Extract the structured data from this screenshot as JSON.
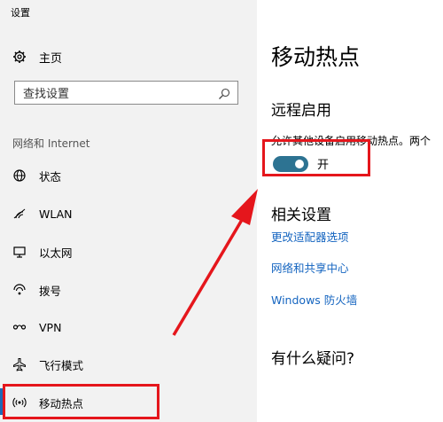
{
  "window": {
    "title": "设置"
  },
  "sidebar": {
    "home_label": "主页",
    "search_placeholder": "查找设置",
    "section_label": "网络和 Internet",
    "items": [
      {
        "label": "状态",
        "icon": "globe-icon"
      },
      {
        "label": "WLAN",
        "icon": "wifi-icon"
      },
      {
        "label": "以太网",
        "icon": "ethernet-icon"
      },
      {
        "label": "拨号",
        "icon": "dialup-icon"
      },
      {
        "label": "VPN",
        "icon": "vpn-icon"
      },
      {
        "label": "飞行模式",
        "icon": "airplane-icon"
      },
      {
        "label": "移动热点",
        "icon": "hotspot-icon",
        "selected": true
      }
    ]
  },
  "main": {
    "title": "移动热点",
    "remote": {
      "heading": "远程启用",
      "description": "允许其他设备启用移动热点。两个",
      "toggle_state": "开",
      "toggle_on": true
    },
    "related": {
      "heading": "相关设置",
      "links": [
        "更改适配器选项",
        "网络和共享中心",
        "Windows 防火墙"
      ]
    },
    "question_heading": "有什么疑问?"
  },
  "colors": {
    "accent": "#1e6ab6",
    "toggle": "#2d7392",
    "link": "#1565c0",
    "annotation": "#e5161c"
  }
}
